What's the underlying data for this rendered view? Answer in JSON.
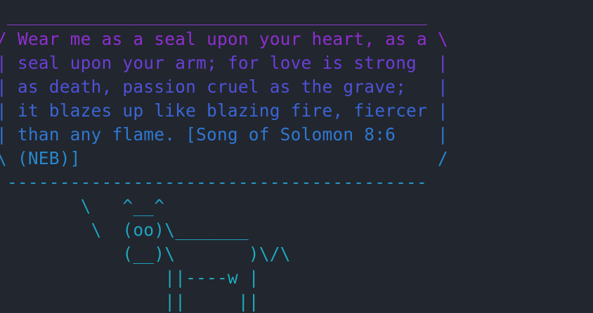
{
  "terminal": {
    "background": "#22262e",
    "lines": [
      {
        "text": " ________________________________________ ",
        "color": "#8a3fd4"
      },
      {
        "text": "/ Wear me as a seal upon your heart, as a \\",
        "color": "#8e2fd0"
      },
      {
        "text": "| seal upon your arm; for love is strong  |",
        "color": "#6a3fd8"
      },
      {
        "text": "| as death, passion cruel as the grave;   |",
        "color": "#4f52d8"
      },
      {
        "text": "| it blazes up like blazing fire, fiercer |",
        "color": "#3a66d6"
      },
      {
        "text": "| than any flame. [Song of Solomon 8:6    |",
        "color": "#2f78d2"
      },
      {
        "text": "\\ (NEB)]                                  /",
        "color": "#2888cc"
      },
      {
        "text": " ---------------------------------------- ",
        "color": "#2398c6"
      },
      {
        "text": "        \\   ^__^",
        "color": "#1e9fc2"
      },
      {
        "text": "         \\  (oo)\\_______",
        "color": "#1ea4c0"
      },
      {
        "text": "            (__)\\       )\\/\\",
        "color": "#1ea8be"
      },
      {
        "text": "                ||----w |",
        "color": "#1eaabc"
      },
      {
        "text": "                ||     ||",
        "color": "#1eacba"
      }
    ]
  }
}
